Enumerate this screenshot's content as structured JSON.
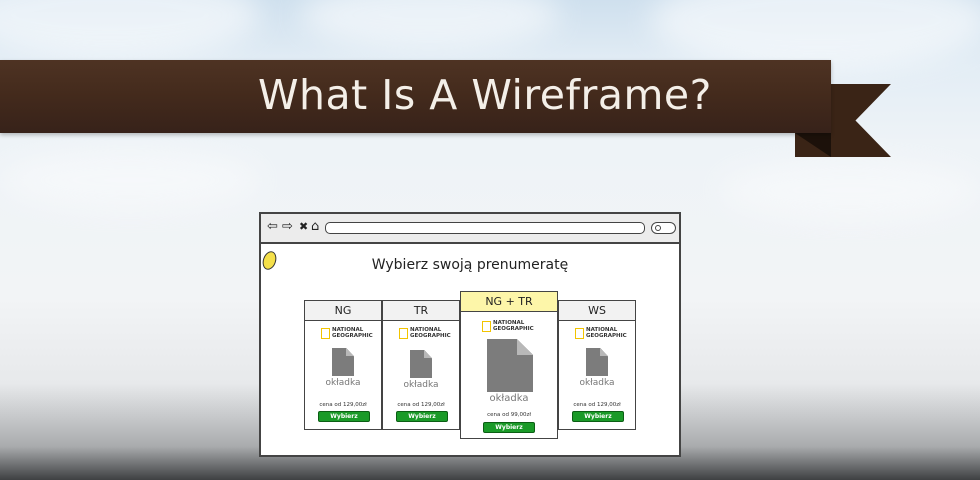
{
  "banner": {
    "title": "What Is A Wireframe?"
  },
  "wireframe": {
    "nav": {
      "back": "⇦",
      "forward": "⇨",
      "stop": "✖",
      "home": "⌂"
    },
    "heading": "Wybierz swoją prenumeratę",
    "cards": [
      {
        "name": "NG",
        "brand_line1": "NATIONAL",
        "brand_line2": "GEOGRAPHIC",
        "cover_label": "okładka",
        "price": "cena od 129,00zł",
        "button": "Wybierz",
        "featured": false
      },
      {
        "name": "TR",
        "brand_line1": "NATIONAL",
        "brand_line2": "GEOGRAPHIC",
        "cover_label": "okładka",
        "price": "cena od 129,00zł",
        "button": "Wybierz",
        "featured": false
      },
      {
        "name": "NG + TR",
        "brand_line1": "NATIONAL",
        "brand_line2": "GEOGRAPHIC",
        "cover_label": "okładka",
        "price": "cena od 99,00zł",
        "button": "Wybierz",
        "featured": true
      },
      {
        "name": "WS",
        "brand_line1": "NATIONAL",
        "brand_line2": "GEOGRAPHIC",
        "cover_label": "okładka",
        "price": "cena od 129,00zł",
        "button": "Wybierz",
        "featured": false
      }
    ]
  },
  "colors": {
    "ribbon": "#432a1c",
    "button": "#1a9a28",
    "highlight": "#fdf6a9",
    "brand_box": "#f2c400"
  }
}
